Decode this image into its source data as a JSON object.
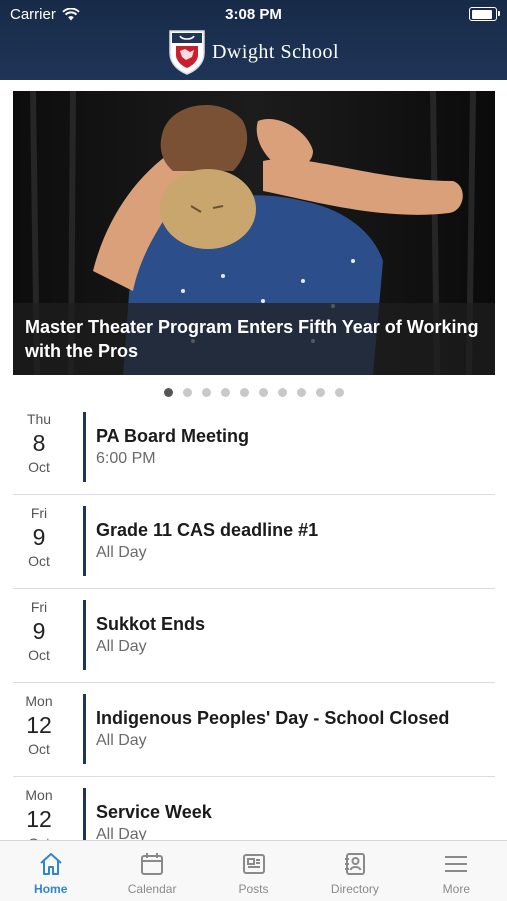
{
  "status": {
    "carrier": "Carrier",
    "time": "3:08 PM",
    "battery_level": 1.0
  },
  "header": {
    "school_name": "Dwight School"
  },
  "hero": {
    "title": "Master Theater Program Enters Fifth Year of Working with the Pros",
    "dot_count": 10,
    "active_dot": 0
  },
  "events": [
    {
      "dow": "Thu",
      "day": "8",
      "month": "Oct",
      "title": "PA Board Meeting",
      "time": "6:00 PM"
    },
    {
      "dow": "Fri",
      "day": "9",
      "month": "Oct",
      "title": "Grade 11 CAS deadline #1",
      "time": "All Day"
    },
    {
      "dow": "Fri",
      "day": "9",
      "month": "Oct",
      "title": "Sukkot Ends",
      "time": "All Day"
    },
    {
      "dow": "Mon",
      "day": "12",
      "month": "Oct",
      "title": "Indigenous Peoples' Day - School Closed",
      "time": "All Day"
    },
    {
      "dow": "Mon",
      "day": "12",
      "month": "Oct",
      "title": "Service Week",
      "time": "All Day"
    }
  ],
  "tabs": [
    {
      "label": "Home",
      "icon": "home-icon",
      "active": true
    },
    {
      "label": "Calendar",
      "icon": "calendar-icon",
      "active": false
    },
    {
      "label": "Posts",
      "icon": "posts-icon",
      "active": false
    },
    {
      "label": "Directory",
      "icon": "directory-icon",
      "active": false
    },
    {
      "label": "More",
      "icon": "menu-icon",
      "active": false
    }
  ],
  "colors": {
    "header_bg": "#1f3558",
    "accent": "#2f86cf",
    "event_bar": "#1f3558"
  }
}
